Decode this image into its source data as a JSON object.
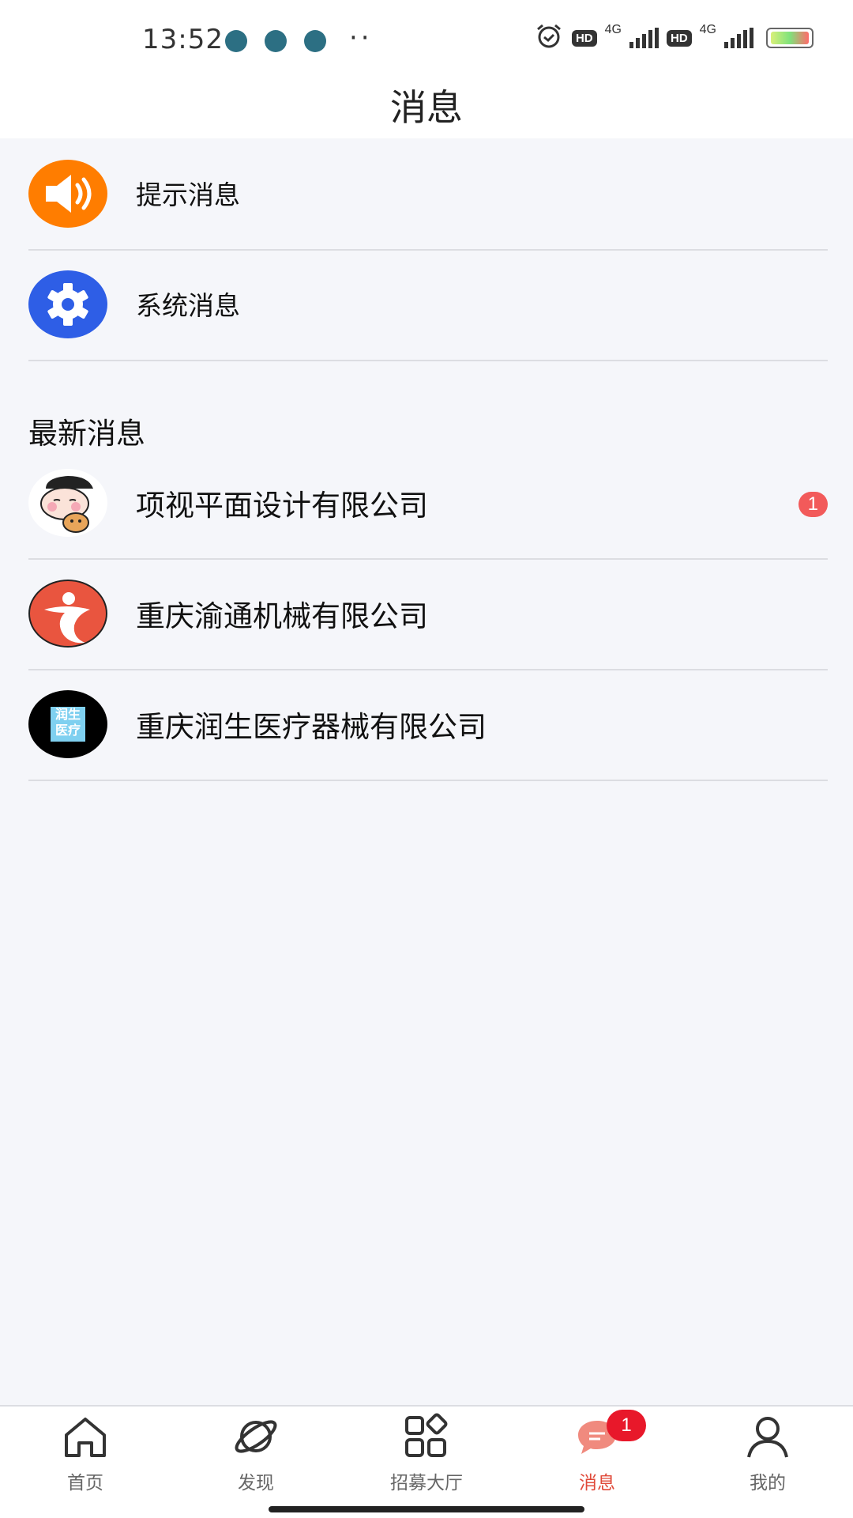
{
  "status_bar": {
    "time": "13:52",
    "network": "4G",
    "hd": "HD"
  },
  "header": {
    "title": "消息"
  },
  "quick": [
    {
      "label": "提示消息",
      "icon": "speaker-icon",
      "color": "#ff7d00"
    },
    {
      "label": "系统消息",
      "icon": "gear-icon",
      "color": "#2e5ee6"
    }
  ],
  "latest": {
    "title": "最新消息",
    "items": [
      {
        "company": "项视平面设计有限公司",
        "badge": "1"
      },
      {
        "company": "重庆渝通机械有限公司"
      },
      {
        "company": "重庆润生医疗器械有限公司",
        "logo_text": "润生医疗"
      }
    ]
  },
  "nav": {
    "items": [
      {
        "label": "首页",
        "icon": "home-icon"
      },
      {
        "label": "发现",
        "icon": "planet-icon"
      },
      {
        "label": "招募大厅",
        "icon": "grid-icon"
      },
      {
        "label": "消息",
        "icon": "chat-icon",
        "badge": "1",
        "active": true
      },
      {
        "label": "我的",
        "icon": "person-icon"
      }
    ]
  },
  "colors": {
    "accent": "#e04a3a",
    "badge": "#f25a5a",
    "nav_badge": "#e8182a"
  }
}
